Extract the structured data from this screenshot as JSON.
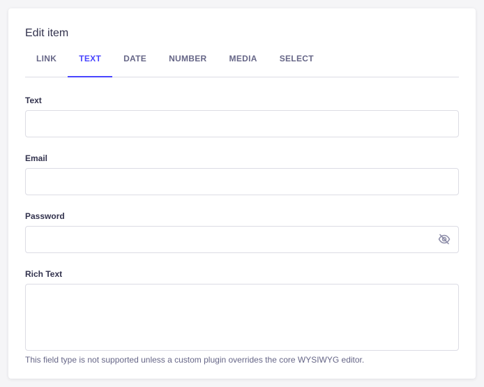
{
  "header": {
    "title": "Edit item"
  },
  "tabs": [
    {
      "label": "LINK",
      "active": false
    },
    {
      "label": "TEXT",
      "active": true
    },
    {
      "label": "DATE",
      "active": false
    },
    {
      "label": "NUMBER",
      "active": false
    },
    {
      "label": "MEDIA",
      "active": false
    },
    {
      "label": "SELECT",
      "active": false
    }
  ],
  "fields": {
    "text": {
      "label": "Text",
      "value": "",
      "placeholder": ""
    },
    "email": {
      "label": "Email",
      "value": "",
      "placeholder": ""
    },
    "password": {
      "label": "Password",
      "value": "",
      "placeholder": "",
      "toggle_icon": "eye-off-icon"
    },
    "rich_text": {
      "label": "Rich Text",
      "hint": "This field type is not supported unless a custom plugin overrides the core WYSIWYG editor."
    }
  },
  "colors": {
    "accent": "#4945ff",
    "border": "#dcdce4",
    "text": "#32324d",
    "muted": "#666687"
  }
}
